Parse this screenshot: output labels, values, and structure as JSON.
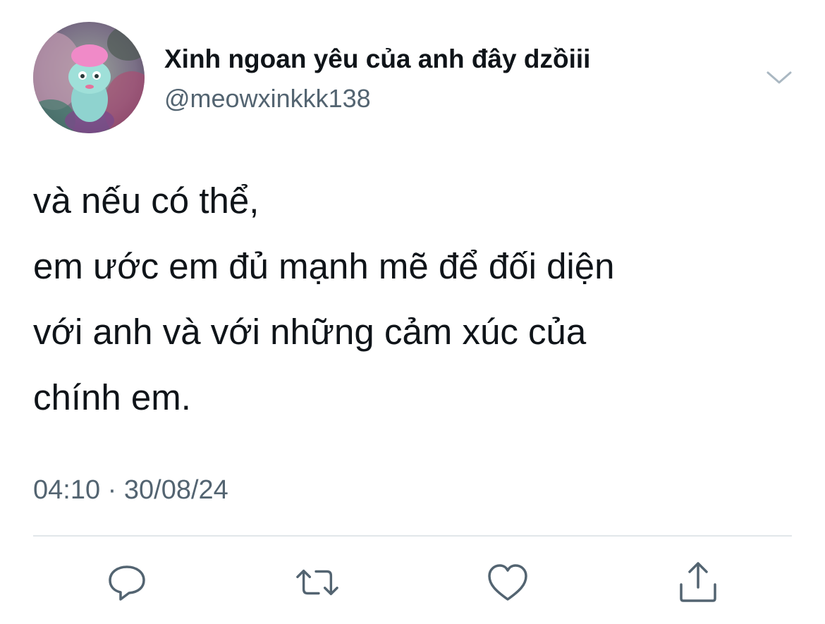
{
  "tweet": {
    "author": {
      "display_name": "Xinh ngoan yêu của anh đây dzồiii",
      "handle": "@meowxinkkk138"
    },
    "text_lines": [
      "và nếu có thể,",
      "em ước em đủ mạnh mẽ để đối diện",
      "với anh và với những cảm xúc của",
      "chính em."
    ],
    "time": "04:10",
    "separator": "·",
    "date": "30/08/24"
  },
  "icons": {
    "more": "chevron-down-icon",
    "reply": "reply-icon",
    "retweet": "retweet-icon",
    "like": "heart-icon",
    "share": "share-icon"
  },
  "colors": {
    "text_primary": "#0f1419",
    "text_secondary": "#536471",
    "icon": "#536471",
    "divider": "#e1e6ea"
  }
}
